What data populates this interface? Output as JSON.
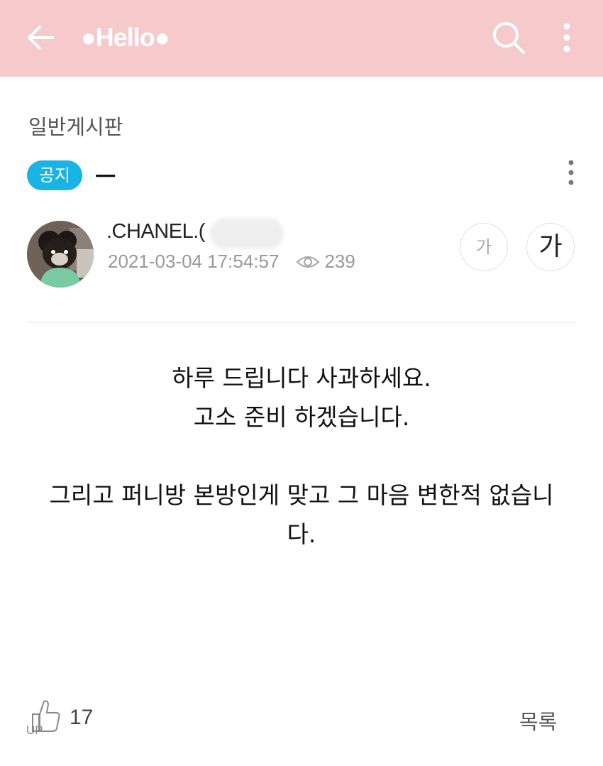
{
  "appbar": {
    "title": "●Hello●",
    "bg_color": "#f6c9cb",
    "icons": [
      "arrow-left-icon",
      "search-icon",
      "kebab-menu-icon"
    ]
  },
  "board": {
    "name": "일반게시판"
  },
  "post": {
    "badge": "공지",
    "badge_color": "#1ab3e6",
    "title": "ㅡ",
    "author": ".CHANEL.(",
    "datetime": "2021-03-04 17:54:57",
    "views": "239",
    "font_small_label": "가",
    "font_large_label": "가",
    "body": [
      "하루 드립니다 사과하세요.",
      "고소 준비 하겠습니다.",
      "그리고 퍼니방 본방인게 맞고 그 마음 변한적 없습니",
      "다."
    ]
  },
  "footer": {
    "like_count": "17",
    "list_label": "목록"
  }
}
